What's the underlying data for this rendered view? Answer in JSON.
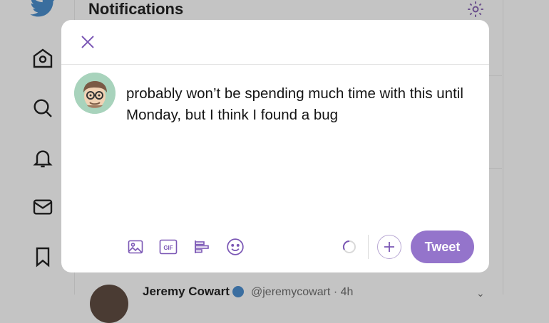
{
  "background": {
    "header_title": "Notifications",
    "row": {
      "name": "Jeremy Cowart",
      "handle": "@jeremycowart · 4h"
    }
  },
  "compose": {
    "text": "probably won’t be spending much time with this until Monday, but I think I found a bug",
    "tweet_label": "Tweet",
    "gif_label": "GIF"
  },
  "colors": {
    "accent": "#7b57b5",
    "tweet_button": "#9474cb",
    "overlay": "#c4c4c4"
  },
  "icons": [
    "twitter-bird-icon",
    "home-icon",
    "search-icon",
    "bell-icon",
    "mail-icon",
    "bookmark-icon",
    "gear-icon",
    "close-icon",
    "image-icon",
    "gif-icon",
    "poll-icon",
    "emoji-icon",
    "plus-icon"
  ]
}
